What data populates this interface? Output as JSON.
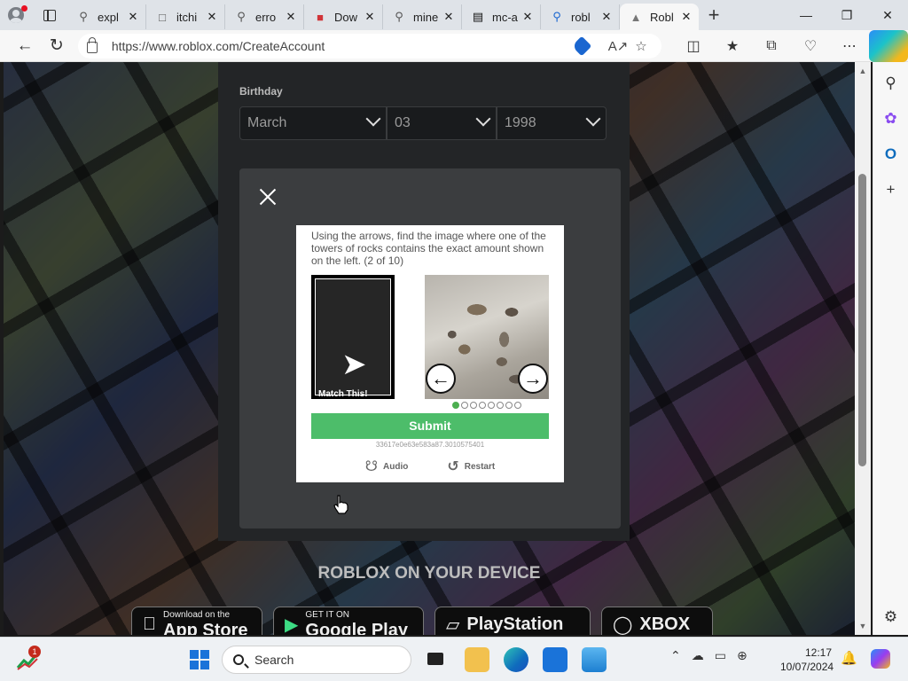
{
  "tabs": [
    {
      "label": "expl",
      "icon": "search-icon"
    },
    {
      "label": "itchi",
      "icon": "document-icon"
    },
    {
      "label": "erro",
      "icon": "search-icon"
    },
    {
      "label": "Dow",
      "icon": "pdf-icon"
    },
    {
      "label": "mine",
      "icon": "search-icon"
    },
    {
      "label": "mc-a",
      "icon": "museum-icon"
    },
    {
      "label": "robl",
      "icon": "bing-search-icon"
    },
    {
      "label": "Robl",
      "icon": "roblox-icon",
      "active": true
    }
  ],
  "address_bar": {
    "url": "https://www.roblox.com/CreateAccount"
  },
  "birthday": {
    "label": "Birthday",
    "month": "March",
    "day": "03",
    "year": "1998"
  },
  "captcha": {
    "instruction": "Using the arrows, find the image where one of the towers of rocks contains the exact amount shown on the left. (2 of 10)",
    "match_label": "Match This!",
    "left_arrow": "←",
    "right_arrow": "→",
    "dot_count": 8,
    "active_dot": 0,
    "submit_label": "Submit",
    "session_id": "33617e0e63e583a87.3010575401",
    "audio_label": "Audio",
    "restart_label": "Restart"
  },
  "footer": {
    "heading": "ROBLOX ON YOUR DEVICE",
    "stores": [
      {
        "small": "Download on the",
        "big": "App Store",
        "icon": "apple-icon"
      },
      {
        "small": "GET IT ON",
        "big": "Google Play",
        "icon": "play-icon"
      },
      {
        "small": "",
        "big": "PlayStation",
        "icon": "playstation-icon"
      },
      {
        "small": "",
        "big": "XBOX",
        "icon": "xbox-icon"
      }
    ]
  },
  "taskbar": {
    "search_placeholder": "Search",
    "notification_count": "1",
    "time": "12:17",
    "date": "10/07/2024"
  },
  "colors": {
    "submit_green": "#4dbd6a",
    "page_dark": "#232527",
    "overlay": "#3b3d3f"
  }
}
